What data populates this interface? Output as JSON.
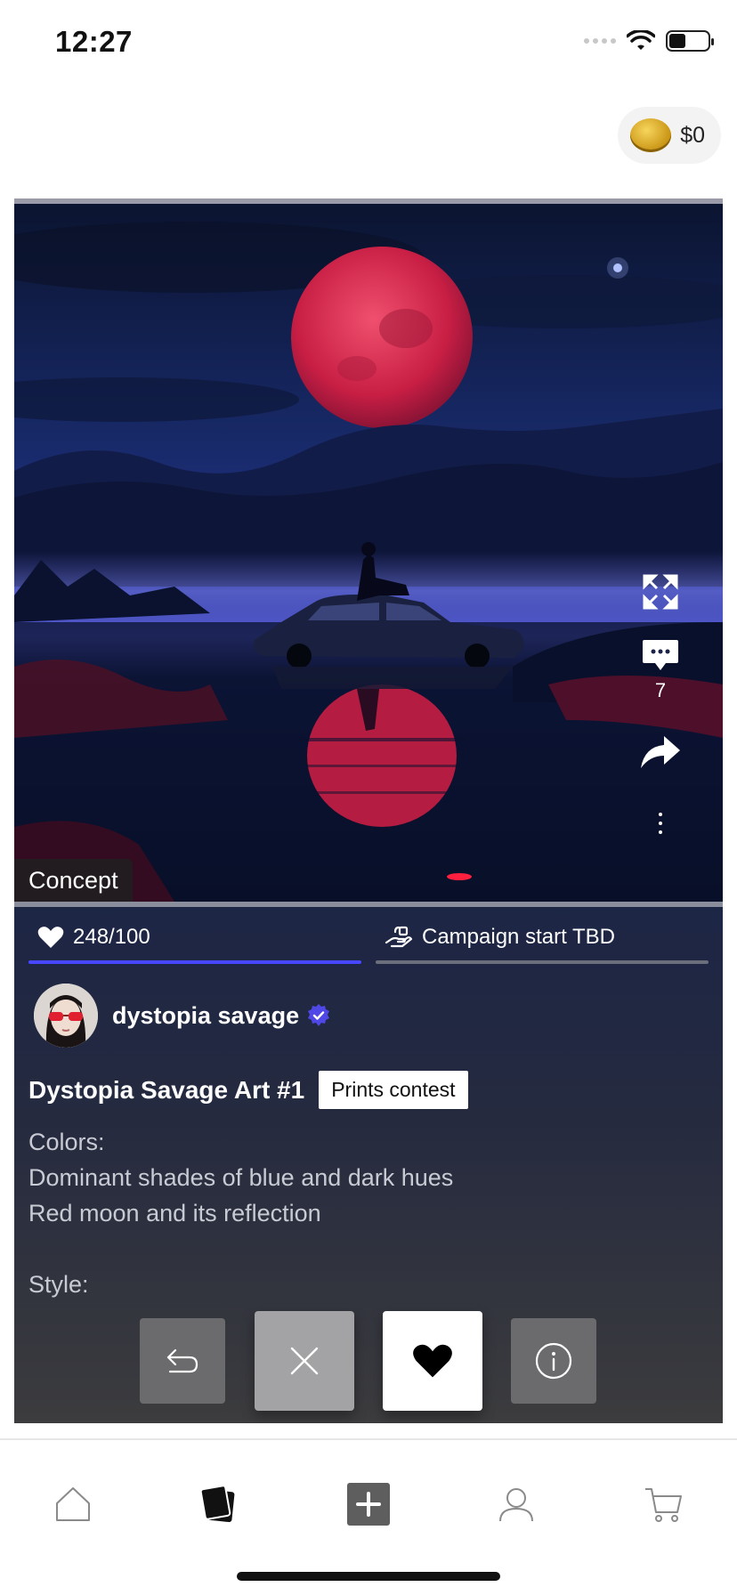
{
  "status_bar": {
    "time": "12:27"
  },
  "wallet": {
    "icon": "coin-icon",
    "amount": "$0"
  },
  "card": {
    "image": {
      "description_icon": "artwork-image",
      "tag": "Concept"
    },
    "side_actions": {
      "expand_icon": "expand-icon",
      "comment_icon": "comment-icon",
      "comment_count": "7",
      "share_icon": "share-icon",
      "more_icon": "more-vertical-icon"
    },
    "progress": {
      "likes_label": "248/100",
      "likes_progress": 1.0,
      "campaign_label": "Campaign start TBD",
      "campaign_progress": 0.0
    },
    "author": {
      "name": "dystopia savage",
      "verified": true
    },
    "title": "Dystopia Savage Art #1",
    "contest_tag": "Prints contest",
    "description": {
      "line1": "Colors:",
      "line2": "Dominant shades of blue and dark hues",
      "line3": "Red moon and its reflection",
      "line4": "Style:"
    },
    "actions": [
      "undo-icon",
      "close-icon",
      "heart-icon",
      "info-icon"
    ]
  },
  "bottom_nav": {
    "items": [
      "home-icon",
      "cards-icon",
      "add-icon",
      "profile-icon",
      "cart-icon"
    ],
    "active": "cards-icon"
  },
  "colors": {
    "accent": "#4747ff",
    "verified": "#5048e6",
    "moon": "#d4224a"
  }
}
